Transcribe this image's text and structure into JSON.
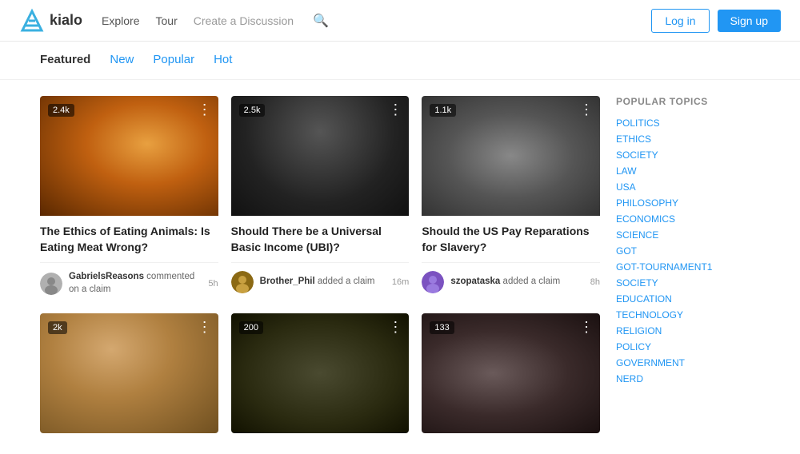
{
  "header": {
    "logo_text": "kialo",
    "nav": {
      "explore": "Explore",
      "tour": "Tour",
      "create_discussion": "Create a Discussion"
    },
    "auth": {
      "login": "Log in",
      "signup": "Sign up"
    }
  },
  "tabs": {
    "featured": "Featured",
    "new": "New",
    "popular": "Popular",
    "hot": "Hot"
  },
  "cards": [
    {
      "id": 1,
      "count": "2.4k",
      "title": "The Ethics of Eating Animals: Is Eating Meat Wrong?",
      "user": "GabrielsReasons",
      "action": "commented on a claim",
      "time": "5h",
      "img_class": "img1"
    },
    {
      "id": 2,
      "count": "2.5k",
      "title": "Should There be a Universal Basic Income (UBI)?",
      "user": "Brother_Phil",
      "action": "added a claim",
      "time": "16m",
      "img_class": "img2"
    },
    {
      "id": 3,
      "count": "1.1k",
      "title": "Should the US Pay Reparations for Slavery?",
      "user": "szopataska",
      "action": "added a claim",
      "time": "8h",
      "img_class": "img3"
    },
    {
      "id": 4,
      "count": "2k",
      "title": "",
      "user": "",
      "action": "",
      "time": "",
      "img_class": "img4"
    },
    {
      "id": 5,
      "count": "200",
      "title": "",
      "user": "",
      "action": "",
      "time": "",
      "img_class": "img5"
    },
    {
      "id": 6,
      "count": "133",
      "title": "",
      "user": "",
      "action": "",
      "time": "",
      "img_class": "img6"
    }
  ],
  "sidebar": {
    "title": "Popular Topics",
    "topics": [
      "POLITICS",
      "ETHICS",
      "SOCIETY",
      "LAW",
      "USA",
      "PHILOSOPHY",
      "ECONOMICS",
      "SCIENCE",
      "GOT",
      "GOT-TOURNAMENT1",
      "SOCIETY",
      "EDUCATION",
      "TECHNOLOGY",
      "RELIGION",
      "POLICY",
      "GOVERNMENT",
      "NERD"
    ]
  }
}
